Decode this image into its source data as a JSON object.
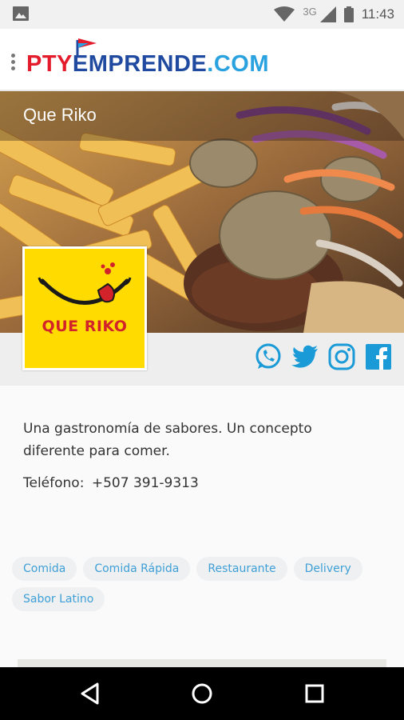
{
  "status_bar": {
    "time": "11:43",
    "network_label": "3G",
    "icons": [
      "image-icon",
      "wifi-icon",
      "signal-icon",
      "battery-icon"
    ]
  },
  "app_bar": {
    "logo": {
      "part1": "PTY",
      "part2": "EMPRENDE",
      "part3": ".COM"
    },
    "colors": {
      "red": "#e31b2b",
      "blue": "#1f4aa0",
      "light_blue": "#2aa2e0"
    }
  },
  "business": {
    "name": "Que Riko",
    "logo_text": "QUE RIKO",
    "description": "Una gastronomía de sabores. Un concepto diferente para comer.",
    "phone_label": "Teléfono:",
    "phone": "+507 391-9313"
  },
  "social": [
    {
      "name": "whatsapp-icon",
      "color": "#1a9ad6"
    },
    {
      "name": "twitter-icon",
      "color": "#1a9ad6"
    },
    {
      "name": "instagram-icon",
      "color": "#1a9ad6"
    },
    {
      "name": "facebook-icon",
      "color": "#1a9ad6"
    }
  ],
  "tags": [
    "Comida",
    "Comida Rápida",
    "Restaurante",
    "Delivery",
    "Sabor Latino"
  ],
  "nav": [
    "back-icon",
    "home-icon",
    "recents-icon"
  ]
}
